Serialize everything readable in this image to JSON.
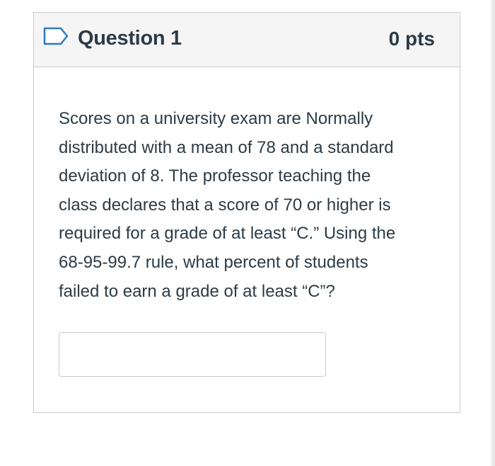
{
  "question": {
    "title": "Question 1",
    "points": "0 pts",
    "bookmark_icon": "bookmark-outline-icon",
    "text_lines": [
      "Scores on a university exam are Normally",
      "distributed with a mean of 78 and a standard",
      "deviation of 8. The professor teaching the",
      "class declares that a score of 70 or higher is",
      "required for a grade of at least “C.” Using the",
      "68-95-99.7 rule, what percent of students",
      "failed to earn a grade of at least “C”?"
    ],
    "answer": {
      "value": "",
      "placeholder": ""
    }
  },
  "colors": {
    "text": "#2d3b45",
    "header_background": "#f5f5f5",
    "border": "#c7cdd1",
    "bookmark_stroke": "#2b7abc"
  }
}
